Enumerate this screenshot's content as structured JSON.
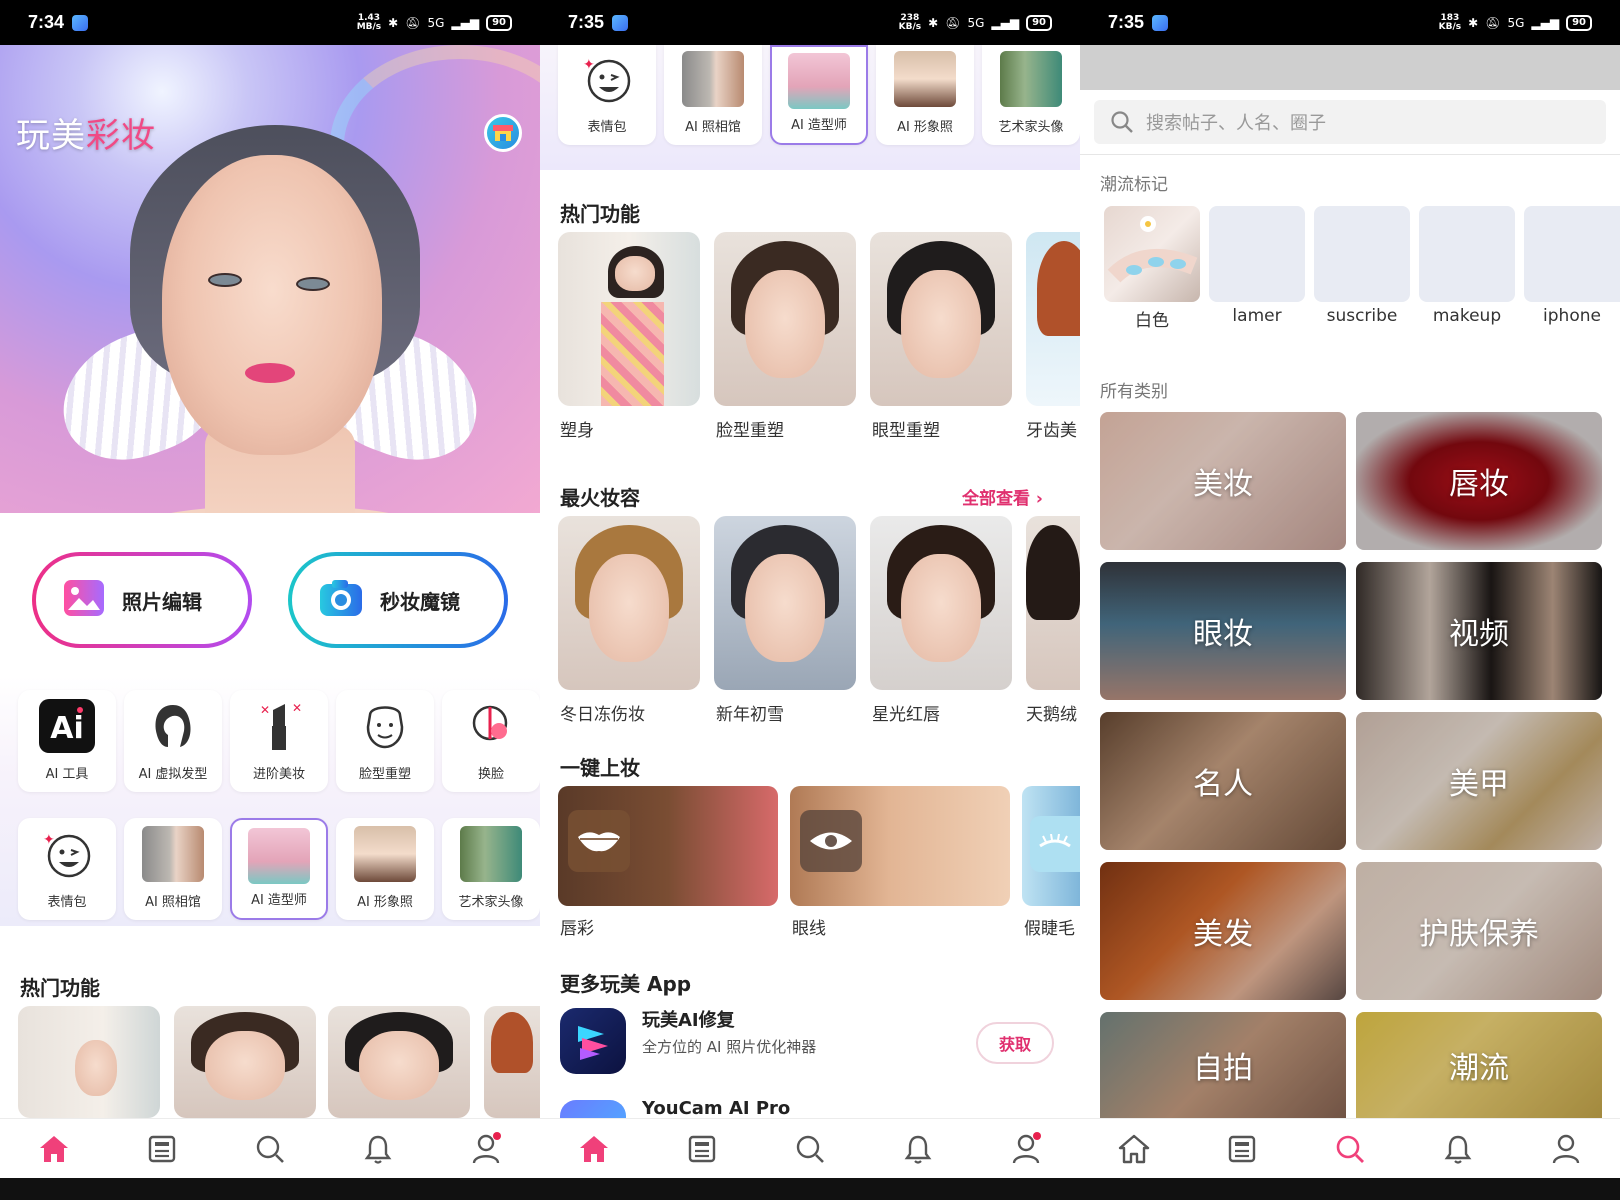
{
  "panel1": {
    "status": {
      "time": "7:34",
      "net_speed": "1.43",
      "net_unit": "MB/s",
      "battery": "90",
      "signal": "5G"
    },
    "app_title_main": "玩美",
    "app_title_accent": "彩妆",
    "actions": [
      {
        "label": "照片编辑",
        "icon": "image-icon"
      },
      {
        "label": "秒妆魔镜",
        "icon": "camera-icon"
      }
    ],
    "tools_row1": [
      "AI 工具",
      "AI 虚拟发型",
      "进阶美妆",
      "脸型重塑",
      "换脸"
    ],
    "tools_row2": [
      "表情包",
      "AI 照相馆",
      "AI 造型师",
      "AI 形象照",
      "艺术家头像"
    ],
    "hot_title": "热门功能"
  },
  "panel2": {
    "status": {
      "time": "7:35",
      "net_speed": "238",
      "net_unit": "KB/s",
      "battery": "90",
      "signal": "5G"
    },
    "top_tiles": [
      "表情包",
      "AI 照相馆",
      "AI 造型师",
      "AI 形象照",
      "艺术家头像"
    ],
    "hot_title": "热门功能",
    "hot_items": [
      "塑身",
      "脸型重塑",
      "眼型重塑",
      "牙齿美"
    ],
    "looks_title": "最火妆容",
    "looks_more": "全部查看 ›",
    "looks": [
      "冬日冻伤妆",
      "新年初雪",
      "星光红唇",
      "天鹅绒"
    ],
    "oneclick_title": "一键上妆",
    "oneclick": [
      "唇彩",
      "眼线",
      "假睫毛"
    ],
    "more_apps_title": "更多玩美 App",
    "apps": [
      {
        "name": "玩美AI修复",
        "desc": "全方位的 AI 照片优化神器",
        "button": "获取"
      },
      {
        "name": "YouCam AI Pro",
        "desc": "",
        "button": ""
      }
    ]
  },
  "panel3": {
    "status": {
      "time": "7:35",
      "net_speed": "183",
      "net_unit": "KB/s",
      "battery": "90",
      "signal": "5G"
    },
    "search_placeholder": "搜索帖子、人名、圈子",
    "trend_title": "潮流标记",
    "trends": [
      "白色",
      "lamer",
      "suscribe",
      "makeup",
      "iphone"
    ],
    "categories_title": "所有类别",
    "categories": [
      "美妆",
      "唇妆",
      "眼妆",
      "视频",
      "名人",
      "美甲",
      "美发",
      "护肤保养",
      "自拍",
      "潮流"
    ]
  },
  "colors": {
    "accent": "#e8214e",
    "link": "#e0306f",
    "active_nav": "#f0407a",
    "inactive_nav": "#555555"
  }
}
